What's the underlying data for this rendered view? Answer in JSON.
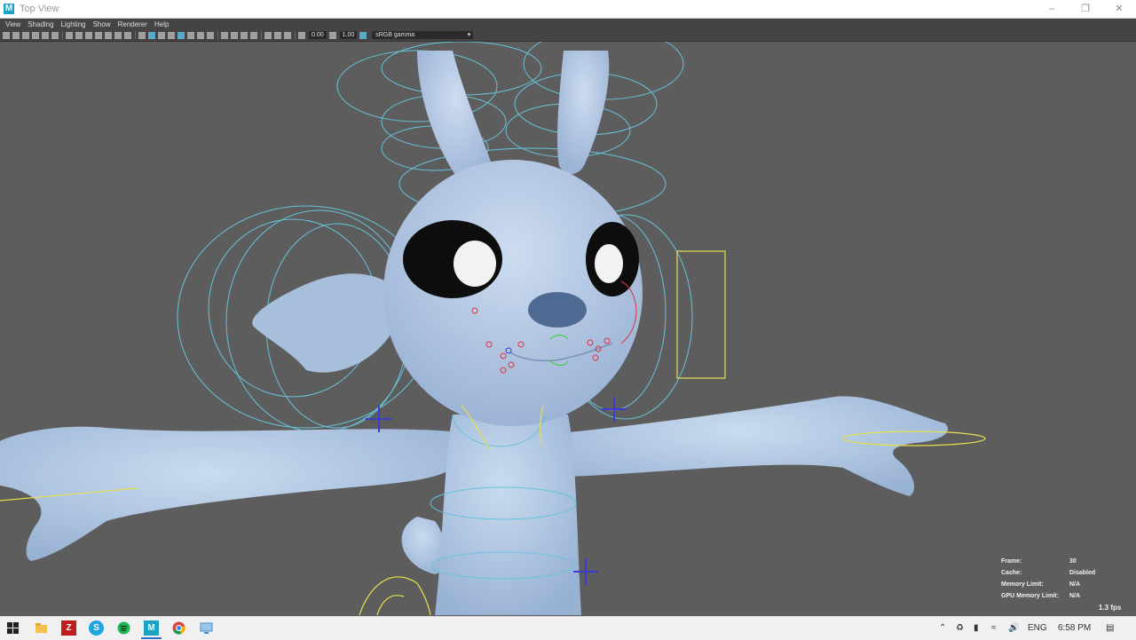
{
  "window": {
    "title": "Top View",
    "app_icon": "maya-icon",
    "controls": [
      "minimize-icon",
      "restore-icon",
      "close-icon"
    ]
  },
  "menu": [
    "View",
    "Shading",
    "Lighting",
    "Show",
    "Renderer",
    "Help"
  ],
  "toolbar": {
    "exposure": "0.00",
    "gamma": "1.00",
    "color_space": "sRGB gamma"
  },
  "hud": {
    "rows": [
      {
        "label": "Frame:",
        "value": "30"
      },
      {
        "label": "Cache:",
        "value": "Disabled"
      },
      {
        "label": "Memory Limit:",
        "value": "N/A"
      },
      {
        "label": "GPU Memory Limit:",
        "value": "N/A"
      }
    ],
    "fps": "1.3 fps"
  },
  "taskbar": {
    "apps": [
      "windows-start-icon",
      "file-explorer-icon",
      "filezilla-icon",
      "skype-icon",
      "spotify-icon",
      "maya-taskbar-icon",
      "chrome-icon",
      "remote-desktop-icon"
    ],
    "language": "ENG",
    "time": "6:58 PM"
  },
  "colors": {
    "viewport": "#5d5d5d",
    "character": "#b3c8e2",
    "control_curve": "#66c3d9",
    "locator_yellow": "#e5e04c",
    "selection_blue": "#3b3bd0"
  }
}
